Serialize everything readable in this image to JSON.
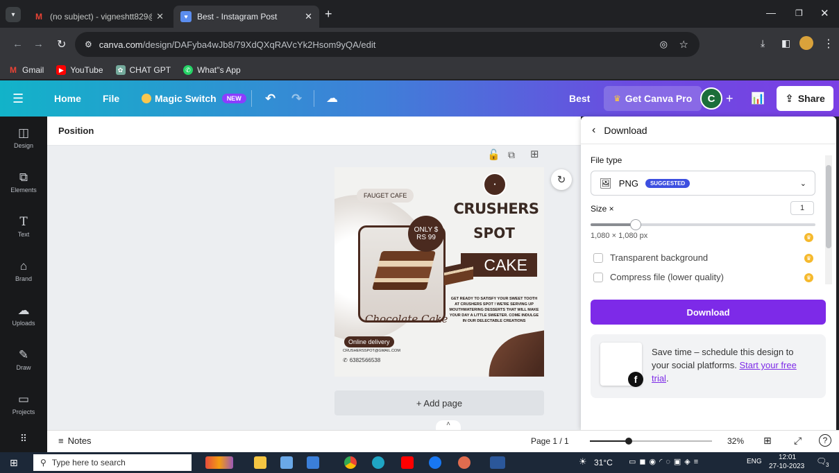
{
  "browser": {
    "tabs": [
      {
        "title": "(no subject) - vigneshtt829@gm",
        "favicon": "gmail-icon"
      },
      {
        "title": "Best - Instagram Post",
        "favicon": "canva-icon"
      }
    ],
    "new_tab": "+",
    "url_domain": "canva.com",
    "url_path": "/design/DAFyba4wJb8/79XdQXqRAVcYk2Hsom9yQA/edit",
    "bookmarks": [
      "Gmail",
      "YouTube",
      "CHAT GPT",
      "What''s App"
    ]
  },
  "header": {
    "home": "Home",
    "file": "File",
    "magic_switch": "Magic Switch",
    "new_badge": "NEW",
    "doc_title": "Best",
    "get_pro": "Get Canva Pro",
    "avatar": "C",
    "share": "Share"
  },
  "sidebar": {
    "items": [
      {
        "label": "Design",
        "icon": "design-icon"
      },
      {
        "label": "Elements",
        "icon": "elements-icon"
      },
      {
        "label": "Text",
        "icon": "text-icon"
      },
      {
        "label": "Brand",
        "icon": "brand-icon"
      },
      {
        "label": "Uploads",
        "icon": "uploads-icon"
      },
      {
        "label": "Draw",
        "icon": "draw-icon"
      },
      {
        "label": "Projects",
        "icon": "projects-icon"
      },
      {
        "label": "",
        "icon": "apps-icon"
      }
    ]
  },
  "toolbar": {
    "position": "Position"
  },
  "design": {
    "cafe": "FAUGET CAFE",
    "brand1": "CRUSHERS",
    "brand2": "SPOT",
    "only1": "ONLY $",
    "only2": "RS 99",
    "cake": "CAKE",
    "blurb": "GET READY TO SATISFY YOUR SWEET TOOTH AT CRUSHERS SPOT ! WE'RE SERVING UP MOUTHWATERING DESSERTS THAT WILL MAKE YOUR DAY A LITTLE SWEETER. COME INDULGE IN OUR DELECTABLE CREATIONS",
    "script": "Chocolate Cake",
    "delivery": "Online delivery",
    "email": "CRUSHERSSPOT@GMAIL.COM",
    "phone": "6382566538"
  },
  "add_page": "+ Add page",
  "panel": {
    "title": "Download",
    "file_type_label": "File type",
    "file_type": "PNG",
    "suggested": "SUGGESTED",
    "size_label": "Size ×",
    "size_value": "1",
    "size_fraction": 0.2,
    "dimensions": "1,080 × 1,080 px",
    "transparent": "Transparent background",
    "compress": "Compress file (lower quality)",
    "download_btn": "Download",
    "promo_text": "Save time – schedule this design to your social platforms.",
    "promo_link": "Start your free trial",
    "promo_end": "."
  },
  "footer": {
    "notes": "Notes",
    "page": "Page 1 / 1",
    "zoom": "32%",
    "zoom_fraction": 0.32
  },
  "taskbar": {
    "search": "Type here to search",
    "weather": "31°C",
    "lang": "ENG",
    "time": "12:01",
    "date": "27-10-2023",
    "notif": "3"
  },
  "colors": {
    "accent": "#7d2ae8",
    "chocolate": "#4a2a1f"
  }
}
